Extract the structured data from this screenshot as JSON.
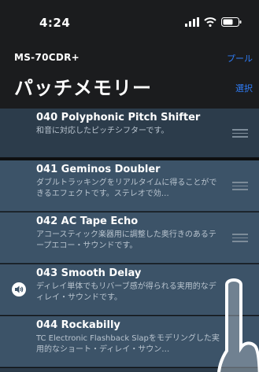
{
  "status": {
    "time": "4:24"
  },
  "nav": {
    "device": "MS-70CDR+",
    "pool_label": "プール",
    "title": "パッチメモリー",
    "select_label": "選択"
  },
  "patches": [
    {
      "title": "040 Polyphonic Pitch Shifter",
      "desc": "和音に対応したピッチシフターです。",
      "playing": false,
      "dim": true
    },
    {
      "title": "041 Geminos Doubler",
      "desc": "ダブルトラッキングをリアルタイムに得ることができるエフェクトです。ステレオで効…",
      "playing": false,
      "dim": false
    },
    {
      "title": "042 AC Tape Echo",
      "desc": "アコースティック楽器用に調整した奥行きのあるテープエコー・サウンドです。",
      "playing": false,
      "dim": false
    },
    {
      "title": "043 Smooth Delay",
      "desc": "ディレイ単体でもリバーブ感が得られる実用的なディレイ・サウンドです。",
      "playing": true,
      "dim": false
    },
    {
      "title": "044 Rockabilly",
      "desc": "TC Electronic Flashback Slapをモデリングした実用的なショート・ディレイ・サウン…",
      "playing": false,
      "dim": false
    }
  ],
  "colors": {
    "row_bg": "#3c5368",
    "row_dim_bg": "#2c3c4b",
    "accent": "#2f7cf6"
  }
}
